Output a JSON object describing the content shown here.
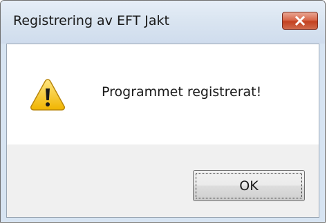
{
  "window": {
    "title": "Registrering av EFT Jakt",
    "close_icon": "close-x-icon"
  },
  "dialog": {
    "icon": "warning-icon",
    "message": "Programmet registrerat!",
    "ok_label": "OK"
  },
  "colors": {
    "close_button": "#c34121",
    "title_bar": "#dae5f1",
    "warning_fill": "#f5c400"
  }
}
